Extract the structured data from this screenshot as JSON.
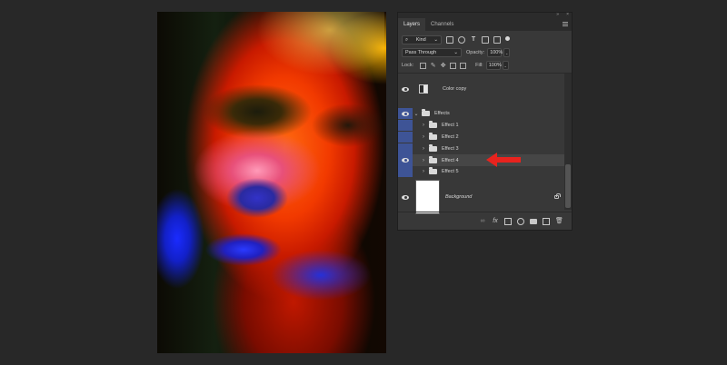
{
  "panel": {
    "collapse_glyph": "»",
    "close_glyph": "×",
    "tabs": [
      {
        "label": "Layers",
        "active": true
      },
      {
        "label": "Channels",
        "active": false
      }
    ],
    "filter": {
      "kind_label": "Kind",
      "icons": [
        "pixel-filter-icon",
        "adjustment-filter-icon",
        "type-filter-icon",
        "shape-filter-icon",
        "smart-object-filter-icon"
      ]
    },
    "blend": {
      "mode": "Pass Through",
      "opacity_label": "Opacity:",
      "opacity": "100%"
    },
    "lock": {
      "label": "Lock:",
      "fill_label": "Fill:",
      "fill": "100%"
    },
    "layers": [
      {
        "name": "Color copy",
        "type": "adjustment",
        "visible": true
      },
      {
        "name": "Effects",
        "type": "group-open",
        "visible": true
      },
      {
        "name": "Effect 1",
        "type": "group",
        "visible": false
      },
      {
        "name": "Effect 2",
        "type": "group",
        "visible": false
      },
      {
        "name": "Effect 3",
        "type": "group",
        "visible": false
      },
      {
        "name": "Effect 4",
        "type": "group",
        "visible": true,
        "selected": true
      },
      {
        "name": "Effect 5",
        "type": "group",
        "visible": false
      },
      {
        "name": "Background",
        "type": "background",
        "visible": true,
        "locked": true
      }
    ],
    "footer_icons": [
      "link-icon",
      "fx-icon",
      "mask-icon",
      "adjustment-icon",
      "new-group-icon",
      "new-layer-icon",
      "trash-icon"
    ],
    "fx_label": "fx"
  },
  "annotation": {
    "arrow_color": "#e8231e"
  }
}
